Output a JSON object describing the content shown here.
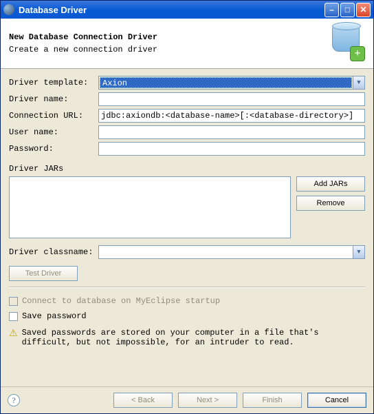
{
  "window": {
    "title": "Database Driver"
  },
  "header": {
    "title": "New Database Connection Driver",
    "subtitle": "Create a new connection driver"
  },
  "form": {
    "driver_template_label": "Driver template:",
    "driver_template_value": "Axion",
    "driver_name_label": "Driver name:",
    "driver_name_value": "",
    "connection_url_label": "Connection URL:",
    "connection_url_value": "jdbc:axiondb:<database-name>[:<database-directory>]",
    "user_name_label": "User name:",
    "user_name_value": "",
    "password_label": "Password:",
    "password_value": ""
  },
  "jars": {
    "label": "Driver JARs",
    "add_label": "Add JARs",
    "remove_label": "Remove"
  },
  "classname": {
    "label": "Driver classname:",
    "value": ""
  },
  "test_driver_label": "Test Driver",
  "options": {
    "connect_startup_label": "Connect to database on MyEclipse startup",
    "save_password_label": "Save password",
    "warning_text": "Saved passwords are stored on your computer in a file that's difficult, but not impossible, for an intruder to read."
  },
  "footer": {
    "back": "< Back",
    "next": "Next >",
    "finish": "Finish",
    "cancel": "Cancel"
  }
}
